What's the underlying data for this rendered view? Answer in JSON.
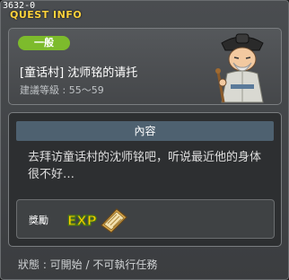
{
  "window": {
    "quest_id": "3632-0",
    "title": "QUEST INFO"
  },
  "quest": {
    "category": "一般",
    "name": "[童话村] 沈师铭的请托",
    "level_range": "建議等級 : 55～59"
  },
  "content": {
    "header": "內容",
    "description": "去拜访童话村的沈师铭吧，听说最近他的身体很不好…"
  },
  "reward": {
    "label": "獎勵",
    "items": [
      {
        "icon": "exp-icon",
        "text": "EXP"
      },
      {
        "icon": "book-icon"
      }
    ]
  },
  "footer": {
    "status": "狀態 : 可開始 / 不可執行任務"
  },
  "colors": {
    "title": "#ffd23c",
    "badge": "#7dbb2c",
    "content_header": "#4e6170",
    "exp_text": "#ffcc00"
  }
}
